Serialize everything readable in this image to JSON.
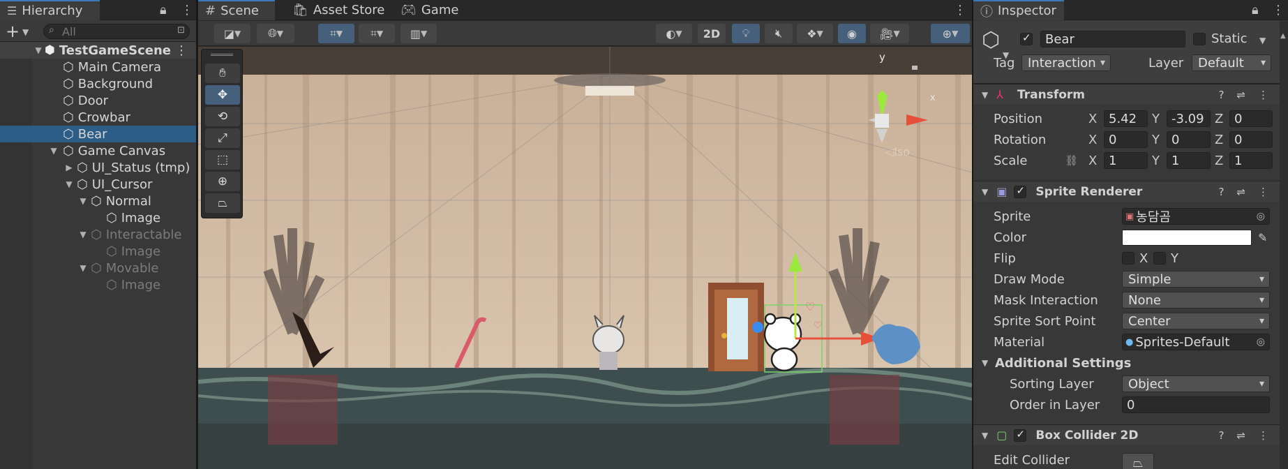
{
  "hierarchy": {
    "tab": "Hierarchy",
    "search_placeholder": "All",
    "add": "+",
    "items": [
      {
        "label": "TestGameScene",
        "bold": true
      },
      {
        "label": "Main Camera"
      },
      {
        "label": "Background"
      },
      {
        "label": "Door"
      },
      {
        "label": "Crowbar"
      },
      {
        "label": "Bear"
      },
      {
        "label": "Game Canvas"
      },
      {
        "label": "UI_Status (tmp)"
      },
      {
        "label": "UI_Cursor"
      },
      {
        "label": "Normal"
      },
      {
        "label": "Image"
      },
      {
        "label": "Interactable"
      },
      {
        "label": "Image"
      },
      {
        "label": "Movable"
      },
      {
        "label": "Image"
      }
    ]
  },
  "scene": {
    "tabs": [
      "Scene",
      "Asset Store",
      "Game"
    ],
    "mode_2d": "2D",
    "gizmo_axes": {
      "y": "y",
      "x": "x"
    },
    "gizmo_view": "◁Iso"
  },
  "inspector": {
    "tab": "Inspector",
    "name": "Bear",
    "static_label": "Static",
    "tag_label": "Tag",
    "tag_value": "Interaction",
    "layer_label": "Layer",
    "layer_value": "Default",
    "transform": {
      "title": "Transform",
      "rows": [
        {
          "label": "Position",
          "x": "5.42",
          "y": "-3.09",
          "z": "0"
        },
        {
          "label": "Rotation",
          "x": "0",
          "y": "0",
          "z": "0"
        },
        {
          "label": "Scale",
          "x": "1",
          "y": "1",
          "z": "1"
        }
      ],
      "axis_x": "X",
      "axis_y": "Y",
      "axis_z": "Z"
    },
    "sprite_renderer": {
      "title": "Sprite Renderer",
      "sprite_label": "Sprite",
      "sprite_value": "농담곰",
      "color_label": "Color",
      "flip_label": "Flip",
      "flip_x": "X",
      "flip_y": "Y",
      "draw_mode_label": "Draw Mode",
      "draw_mode_value": "Simple",
      "mask_label": "Mask Interaction",
      "mask_value": "None",
      "sort_point_label": "Sprite Sort Point",
      "sort_point_value": "Center",
      "material_label": "Material",
      "material_value": "Sprites-Default",
      "additional_title": "Additional Settings",
      "sorting_layer_label": "Sorting Layer",
      "sorting_layer_value": "Object",
      "order_label": "Order in Layer",
      "order_value": "0"
    },
    "box_collider": {
      "title": "Box Collider 2D",
      "edit_label": "Edit Collider"
    }
  }
}
